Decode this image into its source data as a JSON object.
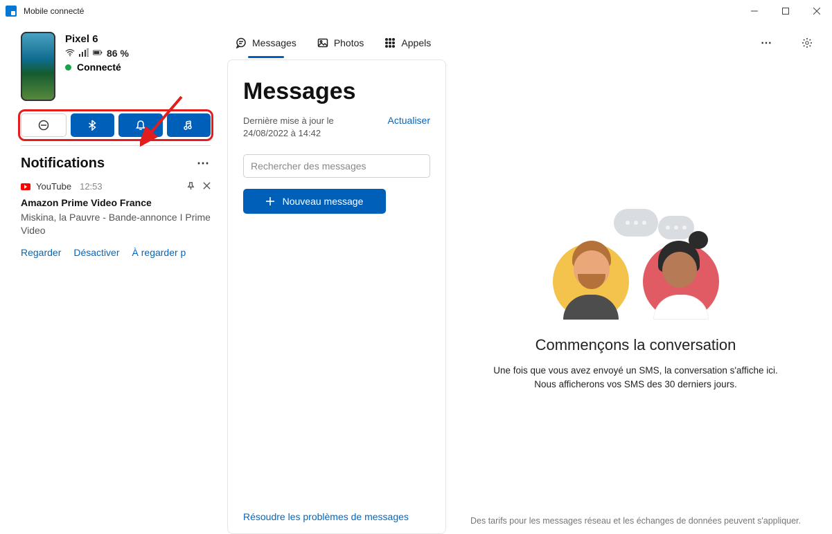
{
  "window": {
    "title": "Mobile connecté"
  },
  "device": {
    "name": "Pixel 6",
    "battery_pct": "86 %",
    "status_text": "Connecté"
  },
  "notifications": {
    "header": "Notifications",
    "item": {
      "app": "YouTube",
      "time": "12:53",
      "title": "Amazon Prime Video France",
      "body": "Miskina, la Pauvre - Bande-annonce I Prime Video",
      "actions": {
        "watch": "Regarder",
        "disable": "Désactiver",
        "later": "À regarder p"
      }
    }
  },
  "tabs": {
    "messages": "Messages",
    "photos": "Photos",
    "calls": "Appels"
  },
  "messages": {
    "title": "Messages",
    "last_update": "Dernière mise à jour le 24/08/2022 à 14:42",
    "refresh": "Actualiser",
    "search_placeholder": "Rechercher des messages",
    "new_message": "Nouveau message",
    "troubleshoot": "Résoudre les problèmes de messages"
  },
  "conversation": {
    "heading": "Commençons la conversation",
    "line1": "Une fois que vous avez envoyé un SMS, la conversation s'affiche ici.",
    "line2": "Nous afficherons vos SMS des 30 derniers jours.",
    "disclaimer": "Des tarifs pour les messages réseau et les échanges de données peuvent s'appliquer."
  }
}
